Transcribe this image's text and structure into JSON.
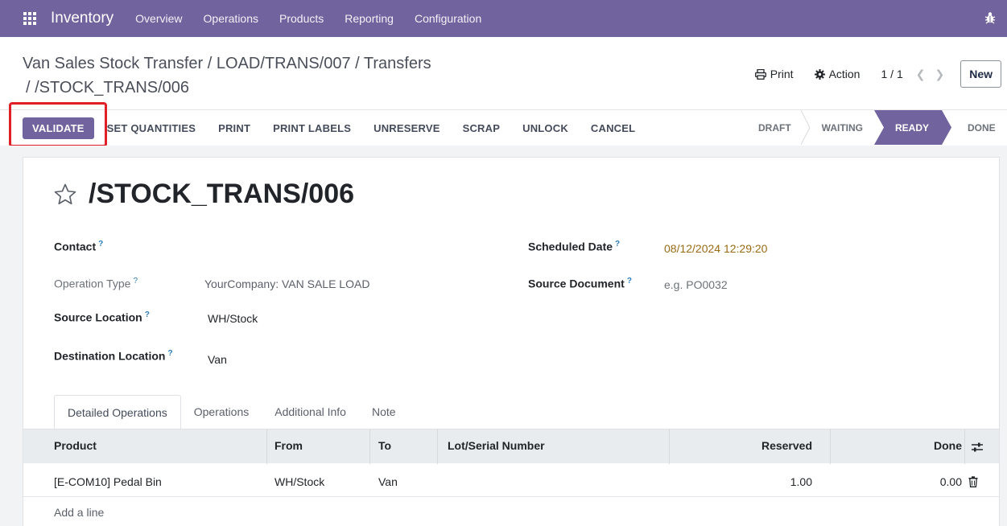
{
  "topbar": {
    "brand": "Inventory",
    "nav": [
      "Overview",
      "Operations",
      "Products",
      "Reporting",
      "Configuration"
    ]
  },
  "breadcrumb": {
    "line1": "Van Sales Stock Transfer / LOAD/TRANS/007 / Transfers",
    "line2": "/ /STOCK_TRANS/006"
  },
  "control": {
    "print_label": "Print",
    "action_label": "Action",
    "pager": "1 / 1",
    "new_label": "New"
  },
  "actions": {
    "validate": "VALIDATE",
    "items": [
      "SET QUANTITIES",
      "PRINT",
      "PRINT LABELS",
      "UNRESERVE",
      "SCRAP",
      "UNLOCK",
      "CANCEL"
    ]
  },
  "stages": {
    "items": [
      "DRAFT",
      "WAITING",
      "READY",
      "DONE"
    ],
    "active": "READY"
  },
  "record": {
    "title": "/STOCK_TRANS/006",
    "help_mark": "?"
  },
  "fields": {
    "contact_label": "Contact",
    "operation_type_label": "Operation Type",
    "operation_type_value": "YourCompany: VAN SALE LOAD",
    "source_location_label": "Source Location",
    "source_location_value": "WH/Stock",
    "destination_location_label": "Destination Location",
    "destination_location_value": "Van",
    "scheduled_date_label": "Scheduled Date",
    "scheduled_date_value": "08/12/2024 12:29:20",
    "source_document_label": "Source Document",
    "source_document_placeholder": "e.g. PO0032"
  },
  "tabs": [
    "Detailed Operations",
    "Operations",
    "Additional Info",
    "Note"
  ],
  "table": {
    "columns": [
      "Product",
      "From",
      "To",
      "Lot/Serial Number",
      "Reserved",
      "Done"
    ],
    "rows": [
      {
        "product": "[E-COM10] Pedal Bin",
        "from": "WH/Stock",
        "to": "Van",
        "lot": "",
        "reserved": "1.00",
        "done": "0.00"
      }
    ],
    "add_line": "Add a line"
  },
  "colors": {
    "brand": "#71639e",
    "highlight": "#e01f26",
    "date": "#9a6b15"
  }
}
